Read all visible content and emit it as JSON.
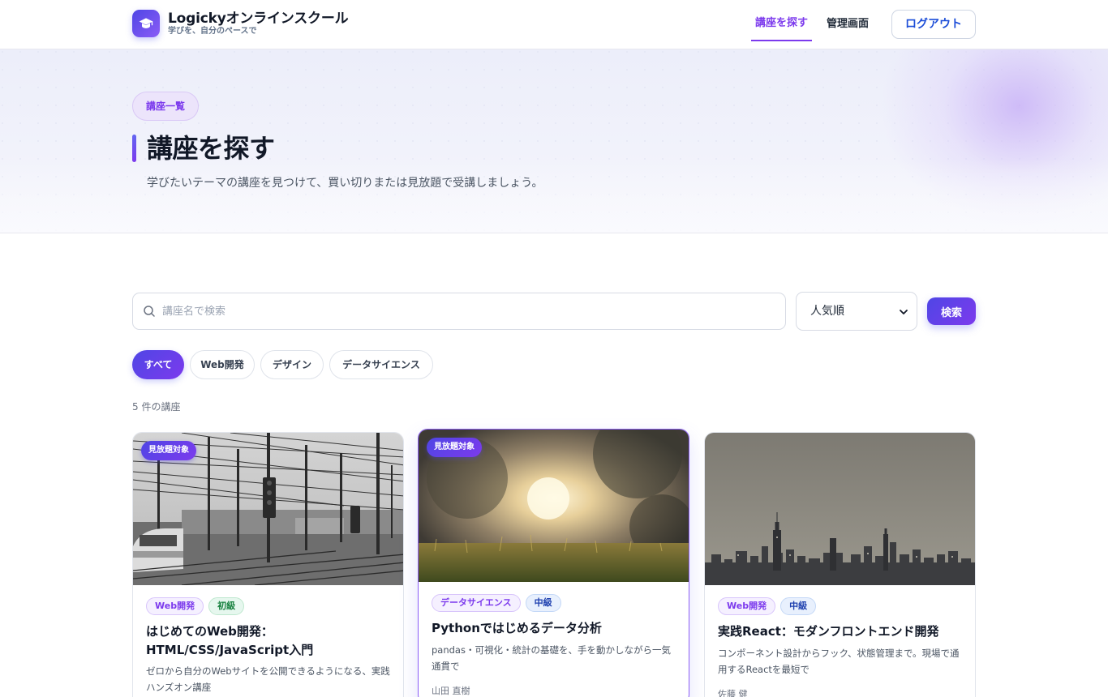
{
  "brand": {
    "name": "Logickyオンラインスクール",
    "tagline": "学びを、自分のペースで"
  },
  "nav": {
    "explore_label": "講座を探す",
    "admin_label": "管理画面",
    "logout_label": "ログアウト"
  },
  "hero": {
    "badge": "講座一覧",
    "title": "講座を探す",
    "description": "学びたいテーマの講座を見つけて、買い切りまたは見放題で受講しましょう。"
  },
  "search": {
    "placeholder": "講座名で検索",
    "sort_selected": "人気順",
    "button_label": "検索"
  },
  "filters": [
    {
      "label": "すべて",
      "active": true
    },
    {
      "label": "Web開発",
      "active": false
    },
    {
      "label": "デザイン",
      "active": false
    },
    {
      "label": "データサイエンス",
      "active": false
    }
  ],
  "result_count": "5 件の講座",
  "courses": [
    {
      "badge": "見放題対象",
      "category": "Web開発",
      "level": "初級",
      "title": "はじめてのWeb開発：HTML/CSS/JavaScript入門",
      "description": "ゼロから自分のWebサイトを公開できるようになる、実践ハンズオン講座",
      "author": "",
      "image": "railway-overhead-lines-bw"
    },
    {
      "badge": "見放題対象",
      "category": "データサイエンス",
      "level": "中級",
      "title": "Pythonではじめるデータ分析",
      "description": "pandas・可視化・統計の基礎を、手を動かしながら一気通貫で",
      "author": "山田 直樹",
      "image": "sunset-grass-field"
    },
    {
      "badge": "",
      "category": "Web開発",
      "level": "中級",
      "title": "実践React：モダンフロントエンド開発",
      "description": "コンポーネント設計からフック、状態管理まで。現場で通用するReactを最短で",
      "author": "佐藤 健",
      "image": "city-skyline-haze"
    }
  ],
  "colors": {
    "accent": "#7c3aed",
    "primary_gradient_start": "#4f46e5",
    "primary_gradient_end": "#7c3aed",
    "link_blue": "#1d4ed8"
  }
}
